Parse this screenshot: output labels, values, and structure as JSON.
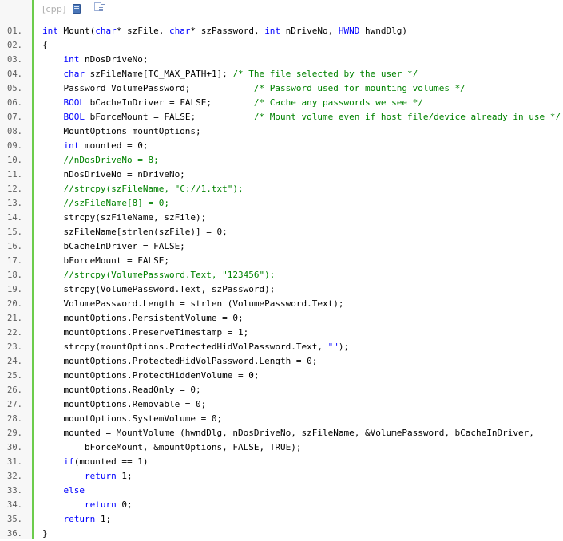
{
  "toolbar": {
    "lang": "[cpp]",
    "view_icon": "view-source-icon",
    "copy_icon": "copy-icon"
  },
  "colors": {
    "keyword": "#0000ff",
    "comment": "#008200",
    "string": "#0000ff",
    "accent_bar": "#6ccc4c",
    "line_number": "#5c5c5c"
  },
  "code_lines": [
    {
      "num": "01.",
      "tokens": [
        [
          "kw",
          "int"
        ],
        [
          "t",
          " Mount("
        ],
        [
          "kw",
          "char"
        ],
        [
          "t",
          "* szFile, "
        ],
        [
          "kw",
          "char"
        ],
        [
          "t",
          "* szPassword, "
        ],
        [
          "kw",
          "int"
        ],
        [
          "t",
          " nDriveNo, "
        ],
        [
          "kw",
          "HWND"
        ],
        [
          "t",
          " hwndDlg)"
        ]
      ]
    },
    {
      "num": "02.",
      "tokens": [
        [
          "t",
          "{"
        ]
      ]
    },
    {
      "num": "03.",
      "tokens": [
        [
          "t",
          "    "
        ],
        [
          "kw",
          "int"
        ],
        [
          "t",
          " nDosDriveNo;"
        ]
      ]
    },
    {
      "num": "04.",
      "tokens": [
        [
          "t",
          "    "
        ],
        [
          "kw",
          "char"
        ],
        [
          "t",
          " szFileName[TC_MAX_PATH+1]; "
        ],
        [
          "cm",
          "/* The file selected by the user */"
        ]
      ]
    },
    {
      "num": "05.",
      "tokens": [
        [
          "t",
          "    Password VolumePassword;            "
        ],
        [
          "cm",
          "/* Password used for mounting volumes */"
        ]
      ]
    },
    {
      "num": "06.",
      "tokens": [
        [
          "t",
          "    "
        ],
        [
          "kw",
          "BOOL"
        ],
        [
          "t",
          " bCacheInDriver = FALSE;        "
        ],
        [
          "cm",
          "/* Cache any passwords we see */"
        ]
      ]
    },
    {
      "num": "07.",
      "tokens": [
        [
          "t",
          "    "
        ],
        [
          "kw",
          "BOOL"
        ],
        [
          "t",
          " bForceMount = FALSE;           "
        ],
        [
          "cm",
          "/* Mount volume even if host file/device already in use */"
        ]
      ]
    },
    {
      "num": "08.",
      "tokens": [
        [
          "t",
          "    MountOptions mountOptions;"
        ]
      ]
    },
    {
      "num": "09.",
      "tokens": [
        [
          "t",
          "    "
        ],
        [
          "kw",
          "int"
        ],
        [
          "t",
          " mounted = 0;"
        ]
      ]
    },
    {
      "num": "10.",
      "tokens": [
        [
          "t",
          "    "
        ],
        [
          "cm",
          "//nDosDriveNo = 8;"
        ]
      ]
    },
    {
      "num": "11.",
      "tokens": [
        [
          "t",
          "    nDosDriveNo = nDriveNo;"
        ]
      ]
    },
    {
      "num": "12.",
      "tokens": [
        [
          "t",
          "    "
        ],
        [
          "cm",
          "//strcpy(szFileName, \"C://1.txt\");"
        ]
      ]
    },
    {
      "num": "13.",
      "tokens": [
        [
          "t",
          "    "
        ],
        [
          "cm",
          "//szFileName[8] = 0;"
        ]
      ]
    },
    {
      "num": "14.",
      "tokens": [
        [
          "t",
          "    strcpy(szFileName, szFile);"
        ]
      ]
    },
    {
      "num": "15.",
      "tokens": [
        [
          "t",
          "    szFileName[strlen(szFile)] = 0;"
        ]
      ]
    },
    {
      "num": "16.",
      "tokens": [
        [
          "t",
          "    bCacheInDriver = FALSE;"
        ]
      ]
    },
    {
      "num": "17.",
      "tokens": [
        [
          "t",
          "    bForceMount = FALSE;"
        ]
      ]
    },
    {
      "num": "18.",
      "tokens": [
        [
          "t",
          "    "
        ],
        [
          "cm",
          "//strcpy(VolumePassword.Text, \"123456\");"
        ]
      ]
    },
    {
      "num": "19.",
      "tokens": [
        [
          "t",
          "    strcpy(VolumePassword.Text, szPassword);"
        ]
      ]
    },
    {
      "num": "20.",
      "tokens": [
        [
          "t",
          "    VolumePassword.Length = strlen (VolumePassword.Text);"
        ]
      ]
    },
    {
      "num": "21.",
      "tokens": [
        [
          "t",
          "    mountOptions.PersistentVolume = 0;"
        ]
      ]
    },
    {
      "num": "22.",
      "tokens": [
        [
          "t",
          "    mountOptions.PreserveTimestamp = 1;"
        ]
      ]
    },
    {
      "num": "23.",
      "tokens": [
        [
          "t",
          "    strcpy(mountOptions.ProtectedHidVolPassword.Text, "
        ],
        [
          "str",
          "\"\""
        ],
        [
          "t",
          ");"
        ]
      ]
    },
    {
      "num": "24.",
      "tokens": [
        [
          "t",
          "    mountOptions.ProtectedHidVolPassword.Length = 0;"
        ]
      ]
    },
    {
      "num": "25.",
      "tokens": [
        [
          "t",
          "    mountOptions.ProtectHiddenVolume = 0;"
        ]
      ]
    },
    {
      "num": "26.",
      "tokens": [
        [
          "t",
          "    mountOptions.ReadOnly = 0;"
        ]
      ]
    },
    {
      "num": "27.",
      "tokens": [
        [
          "t",
          "    mountOptions.Removable = 0;"
        ]
      ]
    },
    {
      "num": "28.",
      "tokens": [
        [
          "t",
          "    mountOptions.SystemVolume = 0;"
        ]
      ]
    },
    {
      "num": "29.",
      "tokens": [
        [
          "t",
          "    mounted = MountVolume (hwndDlg, nDosDriveNo, szFileName, &VolumePassword, bCacheInDriver,"
        ]
      ]
    },
    {
      "num": "30.",
      "tokens": [
        [
          "t",
          "        bForceMount, &mountOptions, FALSE, TRUE);"
        ]
      ]
    },
    {
      "num": "31.",
      "tokens": [
        [
          "t",
          "    "
        ],
        [
          "kw",
          "if"
        ],
        [
          "t",
          "(mounted == 1)"
        ]
      ]
    },
    {
      "num": "32.",
      "tokens": [
        [
          "t",
          "        "
        ],
        [
          "kw",
          "return"
        ],
        [
          "t",
          " 1;"
        ]
      ]
    },
    {
      "num": "33.",
      "tokens": [
        [
          "t",
          "    "
        ],
        [
          "kw",
          "else"
        ]
      ]
    },
    {
      "num": "34.",
      "tokens": [
        [
          "t",
          "        "
        ],
        [
          "kw",
          "return"
        ],
        [
          "t",
          " 0;"
        ]
      ]
    },
    {
      "num": "35.",
      "tokens": [
        [
          "t",
          "    "
        ],
        [
          "kw",
          "return"
        ],
        [
          "t",
          " 1;"
        ]
      ]
    },
    {
      "num": "36.",
      "tokens": [
        [
          "t",
          "}"
        ]
      ]
    }
  ]
}
